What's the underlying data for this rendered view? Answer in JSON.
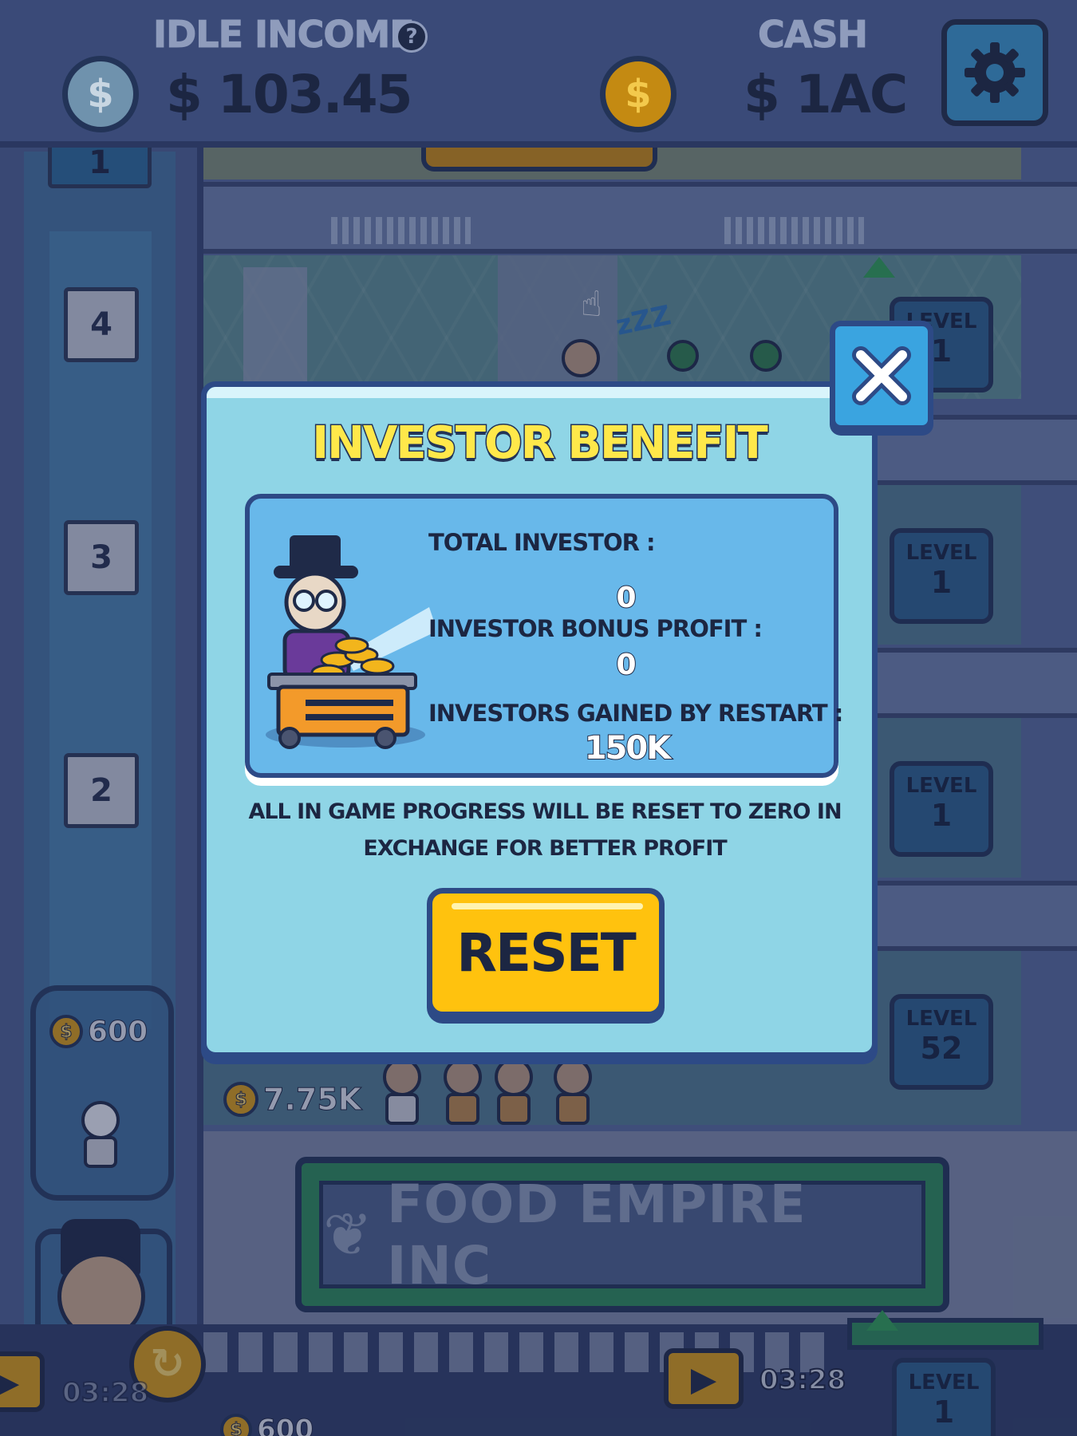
{
  "hud": {
    "idle_income_label": "IDLE INCOME",
    "help_icon_glyph": "?",
    "idle_income_value": "$ 103.45",
    "cash_label": "CASH",
    "cash_value": "$ 1AC",
    "coin_glyph": "$",
    "icons": [
      "help-icon",
      "blue-coin-icon",
      "gold-coin-icon",
      "gear-icon"
    ]
  },
  "modal": {
    "title": "INVESTOR BENEFIT",
    "total_investor_label": "TOTAL INVESTOR :",
    "total_investor_value": "0",
    "bonus_profit_label": "INVESTOR BONUS PROFIT :",
    "bonus_profit_value": "0",
    "gained_label": "INVESTORS GAINED BY RESTART :",
    "gained_value": "150K",
    "note_line1": "ALL IN GAME PROGRESS WILL BE RESET TO ZERO IN",
    "note_line2": "EXCHANGE FOR BETTER PROFIT",
    "reset_label": "RESET",
    "icons": [
      "close-icon",
      "investor-with-coin-cart-illustration"
    ]
  },
  "scene": {
    "elevator_floors": [
      "4",
      "3",
      "2"
    ],
    "top_floor_tag": "1",
    "level_label": "LEVEL",
    "floor_levels": [
      "1",
      "1",
      "1",
      "52"
    ],
    "bottom_level": "1",
    "sign_text": "FOOD EMPIRE INC",
    "side_card_price": "600",
    "counter_value": "7.75K",
    "timer_right": "03:28",
    "timer_left": "03:28",
    "bottom_coin_value": "600",
    "sleep_text": "zZZ",
    "icons": [
      "play-icon",
      "refresh-icon",
      "leaf-icon",
      "up-arrow-icon",
      "pointer-hand-icon"
    ]
  },
  "colors": {
    "hud_bg": "#3a4a78",
    "modal_bg": "#8fd5e6",
    "panel_bg": "#68b8ea",
    "title_yellow": "#ffe84a",
    "reset_yellow": "#ffc20e",
    "close_blue": "#3aa4e0",
    "outline_navy": "#2d4a86"
  }
}
